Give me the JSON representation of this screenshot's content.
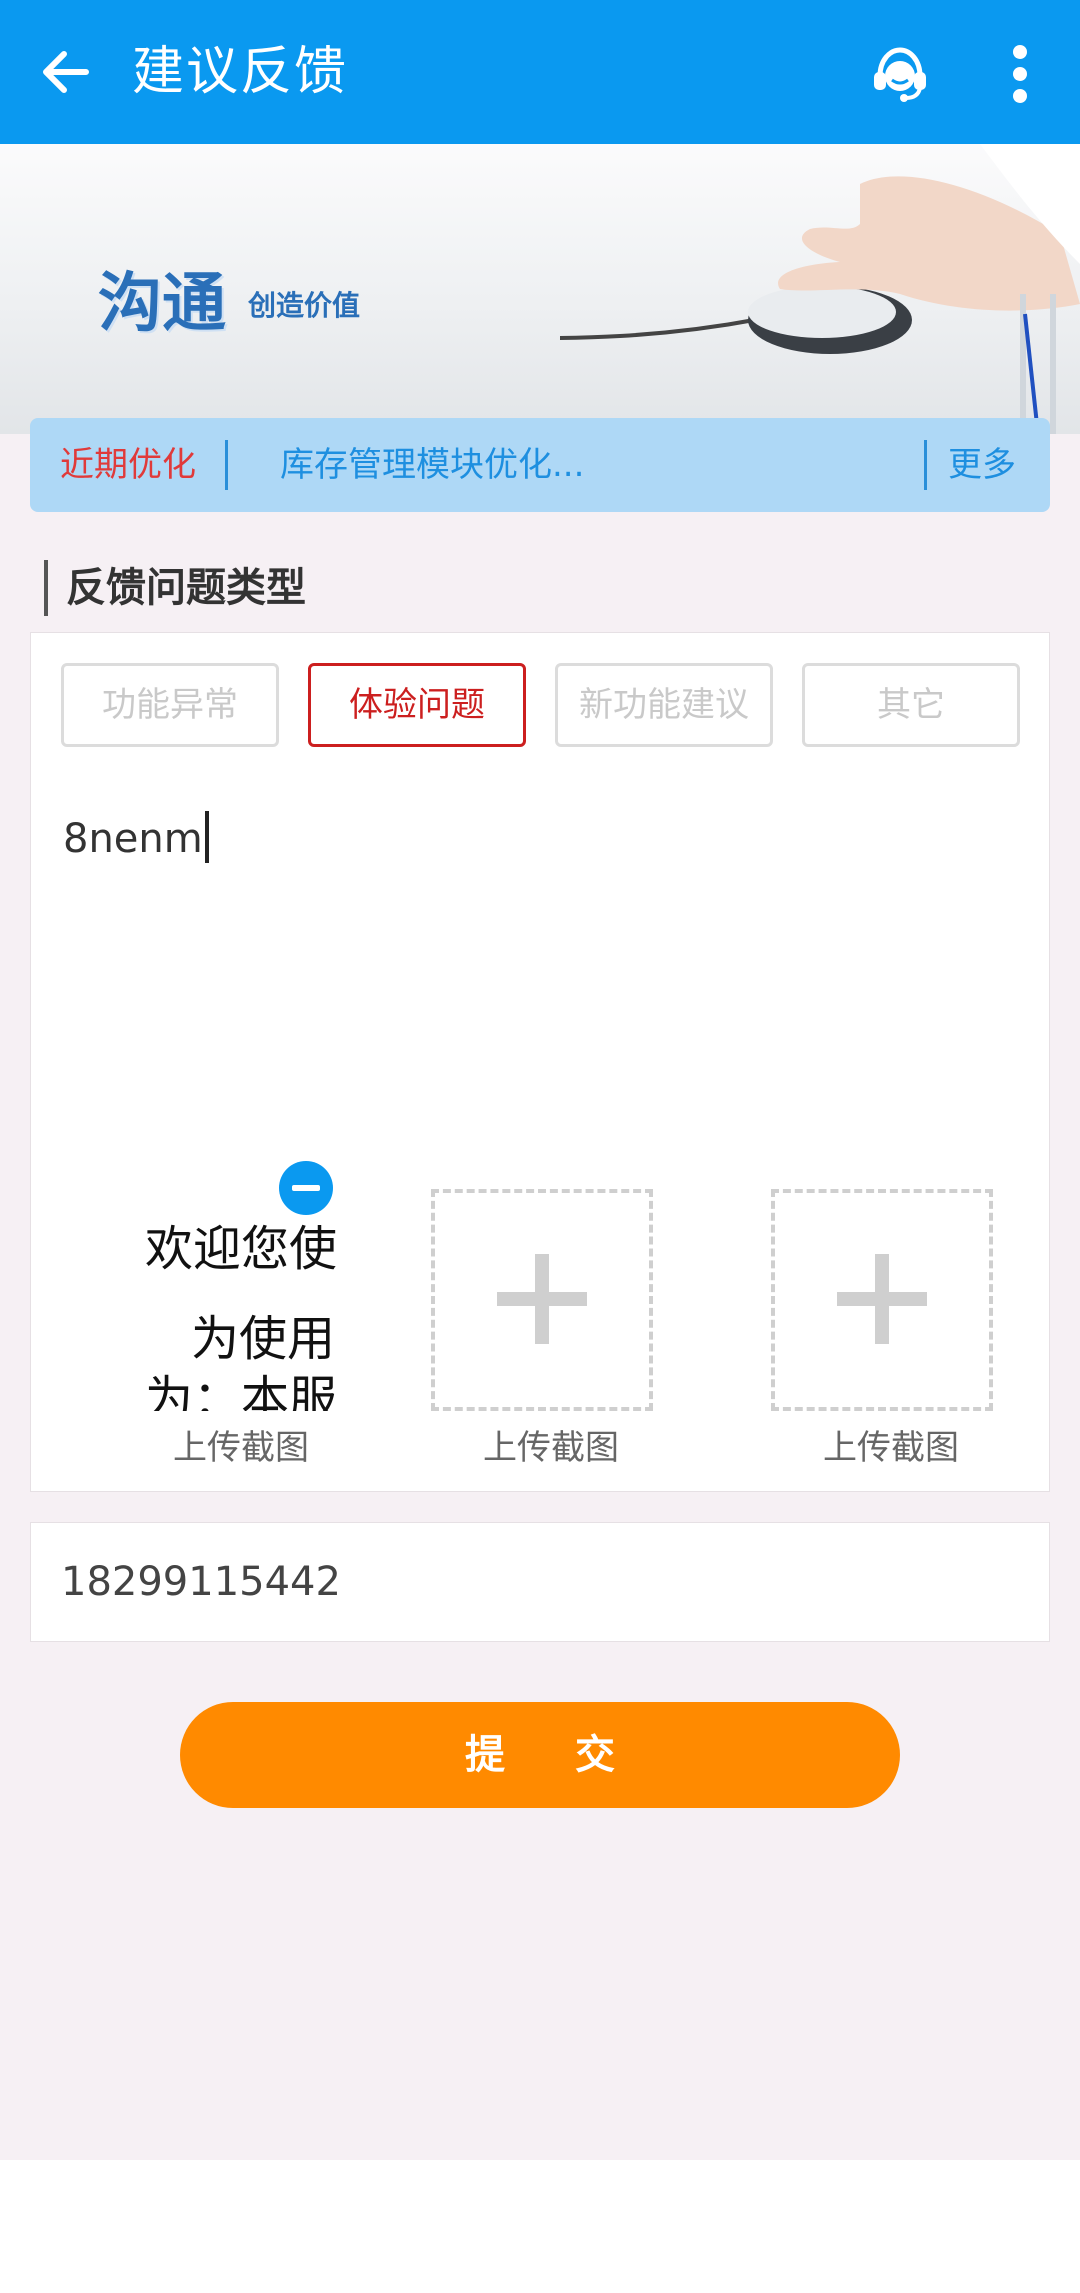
{
  "header": {
    "title": "建议反馈",
    "back_icon": "arrow-left-icon",
    "support_icon": "customer-service-headset-icon",
    "more_icon": "more-vertical-icon",
    "bg_color": "#0a99f0"
  },
  "banner": {
    "slogan_main": "沟通",
    "slogan_sub": "创造价值"
  },
  "notice": {
    "tag": "近期优化",
    "text": "库存管理模块优化...",
    "more": "更多"
  },
  "feedback": {
    "section_title": "反馈问题类型",
    "types": [
      {
        "label": "功能异常",
        "selected": false
      },
      {
        "label": "体验问题",
        "selected": true
      },
      {
        "label": "新功能建议",
        "selected": false
      },
      {
        "label": "其它",
        "selected": false
      }
    ],
    "description_value": "8nenm",
    "screenshot_preview_lines": [
      "欢迎您使",
      "为使用",
      "为：本服"
    ],
    "upload_labels": [
      "上传截图",
      "上传截图",
      "上传截图"
    ]
  },
  "phone": {
    "value": "18299115442"
  },
  "submit": {
    "label": "提 交",
    "color": "#ff8a00"
  }
}
